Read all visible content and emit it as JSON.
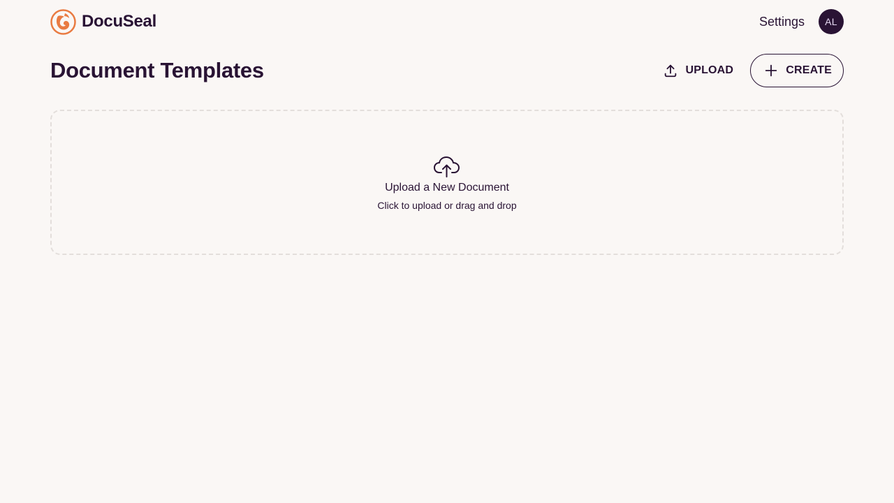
{
  "brand": {
    "name": "DocuSeal",
    "logo_icon": "docuseal-logo-icon",
    "logo_color": "#e97b42"
  },
  "nav": {
    "settings_label": "Settings",
    "avatar_initials": "AL"
  },
  "header": {
    "title": "Document Templates"
  },
  "actions": {
    "upload_label": "UPLOAD",
    "upload_icon": "upload-icon",
    "create_label": "CREATE",
    "create_icon": "plus-icon"
  },
  "dropzone": {
    "icon": "cloud-upload-icon",
    "title": "Upload a New Document",
    "subtitle": "Click to upload or drag and drop"
  },
  "colors": {
    "background": "#faf7f5",
    "primary_text": "#291334",
    "dashed_border": "#e3dedb"
  }
}
